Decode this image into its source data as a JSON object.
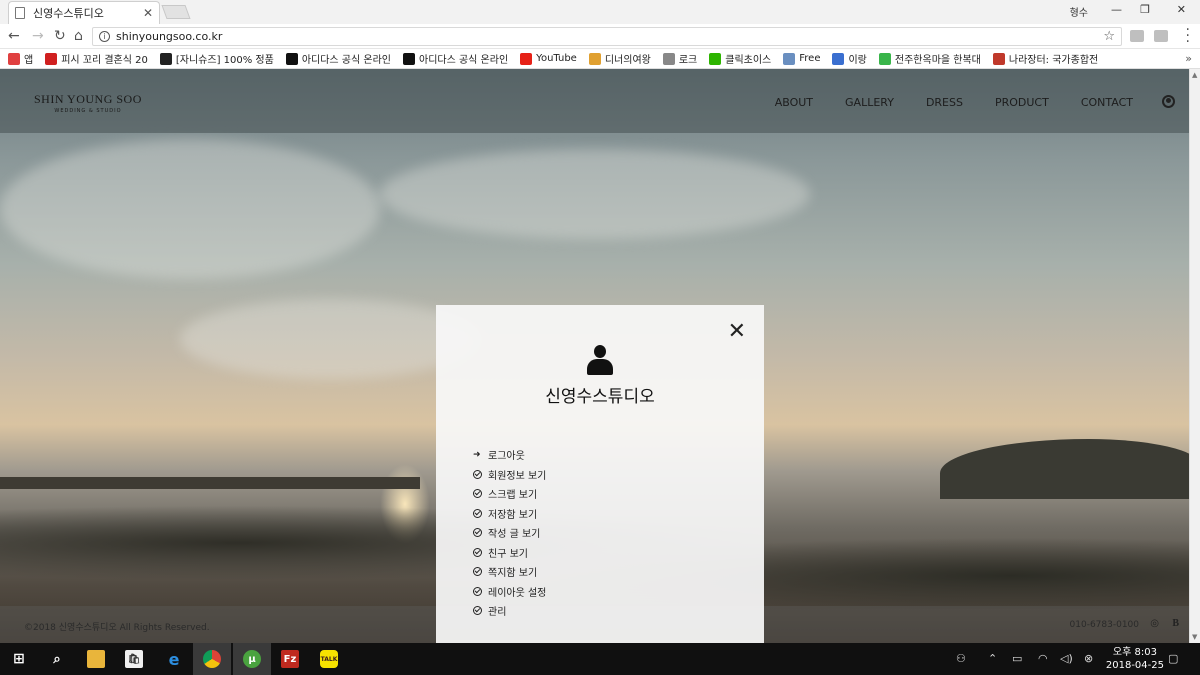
{
  "browser": {
    "tab_title": "신영수스튜디오",
    "tab_close": "✕",
    "profile": "형수",
    "url": "shinyoungsoo.co.kr",
    "bookmarks": [
      {
        "label": "앱",
        "color": "#e04040"
      },
      {
        "label": "피시 꼬리 결혼식 20",
        "color": "#d02020"
      },
      {
        "label": "[자니슈즈] 100% 정품",
        "color": "#222222"
      },
      {
        "label": "아디다스 공식 온라인",
        "color": "#111111"
      },
      {
        "label": "아디다스 공식 온라인",
        "color": "#111111"
      },
      {
        "label": "YouTube",
        "color": "#e62117"
      },
      {
        "label": "디너의여왕",
        "color": "#e0a030"
      },
      {
        "label": "로크",
        "color": "#888888"
      },
      {
        "label": "클릭초이스",
        "color": "#2db400"
      },
      {
        "label": "Free",
        "color": "#6a8fc0"
      },
      {
        "label": "이랑",
        "color": "#3a6fd0"
      },
      {
        "label": "전주한옥마을 한복대",
        "color": "#39b54a"
      },
      {
        "label": "나라장터: 국가종합전",
        "color": "#c0392b"
      }
    ],
    "more": "»"
  },
  "site": {
    "logo_name": "SHIN YOUNG SOO",
    "logo_sub": "WEDDING & STUDIO",
    "nav": [
      "ABOUT",
      "GALLERY",
      "DRESS",
      "PRODUCT",
      "CONTACT"
    ],
    "footer_copyright": "©2018 신영수스튜디오 All Rights Reserved.",
    "footer_phone": "010-6783-0100",
    "footer_icons": [
      "instagram-icon",
      "blog-icon"
    ],
    "footer_blog": "B"
  },
  "modal": {
    "close": "✕",
    "title": "신영수스튜디오",
    "items": [
      "로그아웃",
      "회원정보 보기",
      "스크랩 보기",
      "저장함 보기",
      "작성 글 보기",
      "친구 보기",
      "쪽지함 보기",
      "레이아웃 설정",
      "관리"
    ]
  },
  "taskbar": {
    "apps": [
      "start-icon",
      "search-icon",
      "file-explorer-icon",
      "store-icon",
      "edge-icon",
      "chrome-icon",
      "utorrent-icon",
      "filezilla-icon",
      "kakaotalk-icon"
    ],
    "kakao_label": "TALK",
    "filezilla_label": "Fz",
    "time": "오후 8:03",
    "date": "2018-04-25"
  }
}
